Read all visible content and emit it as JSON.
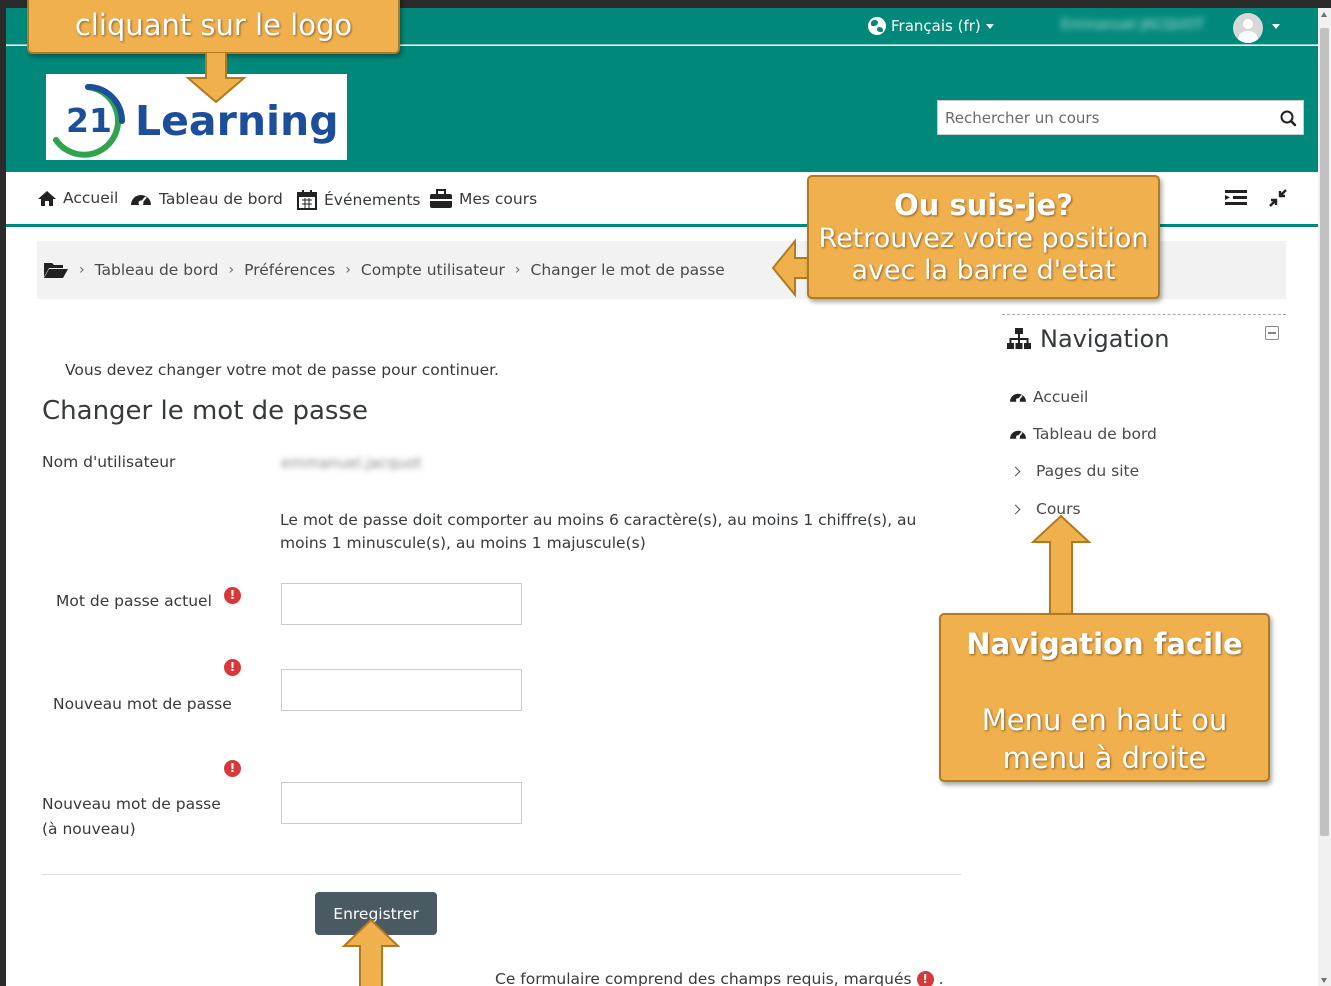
{
  "topbar": {
    "language": "Français (fr)",
    "username": "Emmanuel JACQUOT"
  },
  "header": {
    "logo_number": "21",
    "logo_text": "Learning",
    "search_placeholder": "Rechercher un cours"
  },
  "nav": {
    "items": [
      {
        "label": "Accueil",
        "icon": "home-icon"
      },
      {
        "label": "Tableau de bord",
        "icon": "dashboard-icon"
      },
      {
        "label": "Événements",
        "icon": "calendar-icon"
      },
      {
        "label": "Mes cours",
        "icon": "briefcase-icon"
      }
    ]
  },
  "breadcrumb": {
    "items": [
      "Tableau de bord",
      "Préférences",
      "Compte utilisateur",
      "Changer le mot de passe"
    ]
  },
  "main": {
    "notice": "Vous devez changer votre mot de passe pour continuer.",
    "title": "Changer le mot de passe",
    "username_label": "Nom d'utilisateur",
    "username_value": "emmanuel.jacquot",
    "policy": "Le mot de passe doit comporter au moins 6 caractère(s), au moins 1 chiffre(s), au moins 1 minuscule(s), au moins 1 majuscule(s)",
    "current_label": "Mot de passe actuel",
    "new_label": "Nouveau mot de passe",
    "repeat_label_line1": "Nouveau mot de passe",
    "repeat_label_line2": "(à nouveau)",
    "save_label": "Enregistrer",
    "required_note": "Ce formulaire comprend des champs requis, marqués",
    "required_mark": "!"
  },
  "side": {
    "title": "Navigation",
    "items": [
      "Accueil",
      "Tableau de bord",
      "Pages du site",
      "Cours"
    ]
  },
  "callouts": {
    "logo_line1": "cliquant sur le logo",
    "where_title": "Ou suis-je?",
    "where_line1": "Retrouvez votre position",
    "where_line2": "avec la barre d'etat",
    "nav_title": "Navigation facile",
    "nav_line1": "Menu en haut ou",
    "nav_line2": "menu à droite"
  },
  "colors": {
    "brand": "#00897b",
    "callout": "#f0b04d",
    "required": "#d9383a",
    "button": "#4a5a63"
  }
}
